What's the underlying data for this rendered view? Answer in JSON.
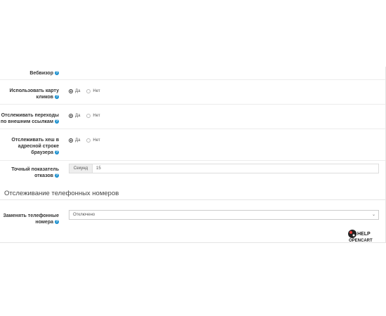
{
  "fields": {
    "webvisor": {
      "label": "Вебвизор",
      "help": "?"
    },
    "click_map": {
      "label_line1": "Использовать карту",
      "label_line2": "кликов",
      "help": "?",
      "yes": "Да",
      "no": "Нет",
      "value": "yes"
    },
    "external_links": {
      "label_line1": "Отслеживать переходы",
      "label_line2": "по внешним ссылкам",
      "help": "?",
      "yes": "Да",
      "no": "Нет",
      "value": "yes"
    },
    "hash_tracking": {
      "label_line1": "Отслеживать хеш в",
      "label_line2": "адресной строке",
      "label_line3": "браузера",
      "help": "?",
      "yes": "Да",
      "no": "Нет",
      "value": "yes"
    },
    "bounce_rate": {
      "label_line1": "Точный показатель",
      "label_line2": "отказов",
      "help": "?",
      "addon": "Секунд",
      "value": "15"
    }
  },
  "phone_section": {
    "title": "Отслеживание телефонных номеров",
    "replace_numbers": {
      "label_line1": "Заменять телефонные",
      "label_line2": "номера",
      "help": "?",
      "selected": "Отключено"
    }
  },
  "logo": {
    "top_text": "HELP",
    "bottom_text": "OPENCART",
    "accent": "#e53935"
  }
}
